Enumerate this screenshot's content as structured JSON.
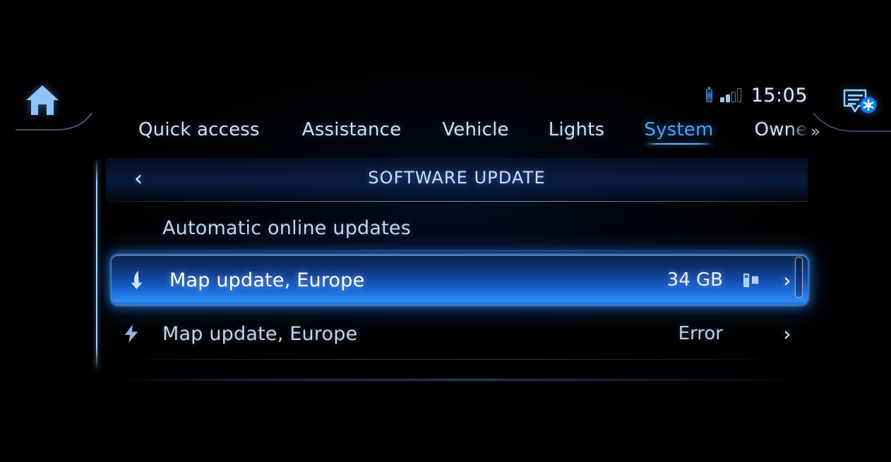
{
  "status_bar": {
    "battery_icon": "battery-icon",
    "signal_icon": "signal-bars-icon",
    "signal_bars_filled": 2,
    "signal_bars_total": 4,
    "time": "15:05"
  },
  "home_button": {
    "icon": "home-icon"
  },
  "notification_button": {
    "icon": "messages-alert-icon"
  },
  "tabs": {
    "items": [
      {
        "label": "Quick access",
        "active": false
      },
      {
        "label": "Assistance",
        "active": false
      },
      {
        "label": "Vehicle",
        "active": false
      },
      {
        "label": "Lights",
        "active": false
      },
      {
        "label": "System",
        "active": true
      },
      {
        "label": "Owner",
        "active": false
      }
    ],
    "overflow_indicator": "»"
  },
  "panel": {
    "back_icon": "chevron-left-icon",
    "title": "SOFTWARE UPDATE"
  },
  "list": {
    "rows": [
      {
        "label": "Automatic online updates",
        "value": "",
        "leading_icon": "",
        "media_icon": "",
        "chevron": "",
        "selected": false
      },
      {
        "label": "Map update, Europe",
        "value": "34 GB",
        "leading_icon": "download-arrow-icon",
        "media_icon": "usb-drive-icon",
        "chevron": "›",
        "selected": true
      },
      {
        "label": "Map update, Europe",
        "value": "Error",
        "leading_icon": "lightning-bolt-icon",
        "media_icon": "",
        "chevron": "›",
        "selected": false
      }
    ]
  },
  "scrollbar": {
    "name": "vertical-scrollbar"
  },
  "colors": {
    "background": "#000000",
    "accent_blue": "#2a8bf2",
    "active_tab": "#4f9ef0",
    "text_primary": "#c8d7ec",
    "selected_text": "#ffffff",
    "accent_line": "#b9deff"
  }
}
